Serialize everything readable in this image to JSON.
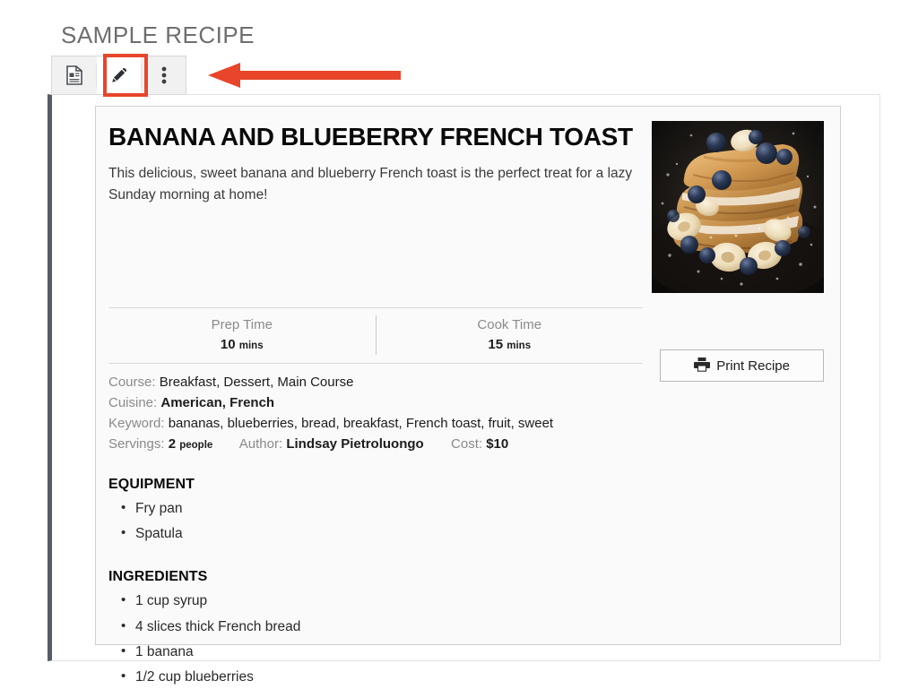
{
  "page": {
    "heading": "SAMPLE RECIPE"
  },
  "toolbar": {
    "buttons": [
      {
        "name": "document-icon",
        "label": "Document"
      },
      {
        "name": "edit-icon",
        "label": "Edit"
      },
      {
        "name": "more-options-icon",
        "label": "More options"
      }
    ],
    "active_index": 1,
    "highlight_color": "#e8452b"
  },
  "annotation": {
    "arrow_color": "#e8452b",
    "direction": "left",
    "points_to": "edit-icon"
  },
  "recipe": {
    "title": "BANANA AND BLUEBERRY FRENCH TOAST",
    "summary": "This delicious, sweet banana and blueberry French toast is the perfect treat for a lazy Sunday morning at home!",
    "photo_alt": "Stack of French toast topped with blueberries and banana slices on a dark skillet",
    "times": [
      {
        "label": "Prep Time",
        "value": "10",
        "unit": "mins"
      },
      {
        "label": "Cook Time",
        "value": "15",
        "unit": "mins"
      }
    ],
    "meta": {
      "course_key": "Course:",
      "course_value": "Breakfast, Dessert, Main Course",
      "cuisine_key": "Cuisine:",
      "cuisine_value": "American, French",
      "keyword_key": "Keyword:",
      "keyword_value": "bananas, blueberries, bread, breakfast, French toast, fruit, sweet",
      "servings_key": "Servings:",
      "servings_value": "2",
      "servings_unit": "people",
      "author_key": "Author:",
      "author_value": "Lindsay Pietroluongo",
      "cost_key": "Cost:",
      "cost_value": "$10"
    },
    "print_button_label": "Print Recipe",
    "equipment": {
      "title": "EQUIPMENT",
      "items": [
        "Fry pan",
        "Spatula"
      ]
    },
    "ingredients": {
      "title": "INGREDIENTS",
      "items": [
        "1 cup syrup",
        "4 slices thick French bread",
        "1 banana",
        "1/2 cup blueberries"
      ]
    }
  }
}
